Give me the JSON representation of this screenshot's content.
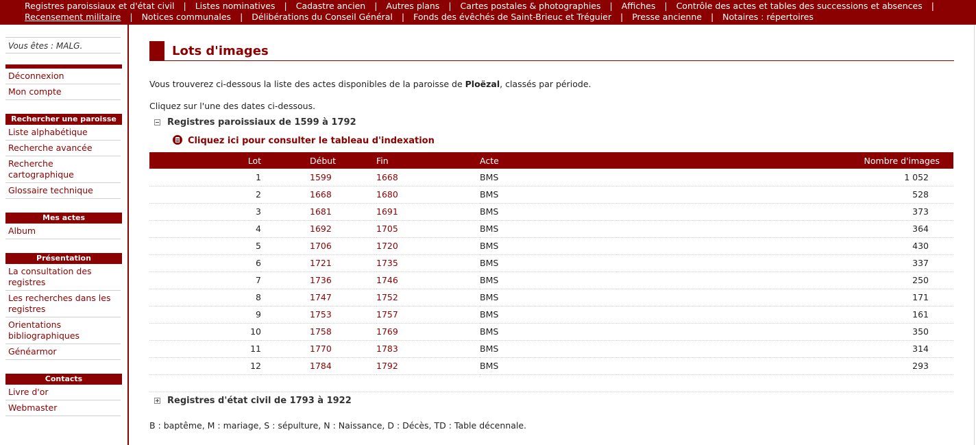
{
  "topnav": {
    "row1": [
      "Registres paroissiaux et d'état civil",
      "Listes nominatives",
      "Cadastre ancien",
      "Autres plans",
      "Cartes postales & photographies",
      "Affiches",
      "Contrôle des actes et tables des successions et absences"
    ],
    "row2": [
      "Recensement militaire",
      "Notices communales",
      "Délibérations du Conseil Général",
      "Fonds des évêchés de Saint-Brieuc et Tréguier",
      "Presse ancienne",
      "Notaires : répertoires"
    ],
    "separator": "|"
  },
  "sidebar": {
    "user": "Vous êtes : MALG.",
    "account": [
      "Déconnexion",
      "Mon compte"
    ],
    "search": {
      "heading": "Rechercher une paroisse",
      "items": [
        "Liste alphabétique",
        "Recherche avancée",
        "Recherche cartographique",
        "Glossaire technique"
      ]
    },
    "mes_actes": {
      "heading": "Mes actes",
      "items": [
        "Album"
      ]
    },
    "presentation": {
      "heading": "Présentation",
      "items": [
        "La consultation des registres",
        "Les recherches dans les registres",
        "Orientations bibliographiques",
        "Généarmor"
      ]
    },
    "contacts": {
      "heading": "Contacts",
      "items": [
        "Livre d'or",
        "Webmaster"
      ]
    }
  },
  "main": {
    "title": "Lots d'images",
    "intro_before": "Vous trouverez ci-dessous la liste des actes disponibles de la paroisse de ",
    "parish": "Ploëzal",
    "intro_after": ", classés par période.",
    "instruction": "Cliquez sur l'une des dates ci-dessous.",
    "section1": "Registres paroissiaux de 1599 à 1792",
    "index_link": "Cliquez ici pour consulter le tableau d'indexation",
    "table": {
      "headers": [
        "Lot",
        "Début",
        "Fin",
        "Acte",
        "Nombre d'images"
      ],
      "rows": [
        [
          "1",
          "1599",
          "1668",
          "BMS",
          "1 052"
        ],
        [
          "2",
          "1668",
          "1680",
          "BMS",
          "528"
        ],
        [
          "3",
          "1681",
          "1691",
          "BMS",
          "373"
        ],
        [
          "4",
          "1692",
          "1705",
          "BMS",
          "364"
        ],
        [
          "5",
          "1706",
          "1720",
          "BMS",
          "430"
        ],
        [
          "6",
          "1721",
          "1735",
          "BMS",
          "337"
        ],
        [
          "7",
          "1736",
          "1746",
          "BMS",
          "250"
        ],
        [
          "8",
          "1747",
          "1752",
          "BMS",
          "171"
        ],
        [
          "9",
          "1753",
          "1757",
          "BMS",
          "161"
        ],
        [
          "10",
          "1758",
          "1769",
          "BMS",
          "350"
        ],
        [
          "11",
          "1770",
          "1783",
          "BMS",
          "314"
        ],
        [
          "12",
          "1784",
          "1792",
          "BMS",
          "293"
        ]
      ]
    },
    "section2": "Registres d'état civil de 1793 à 1922",
    "legend": "B : baptême, M : mariage, S : sépulture, N : Naissance, D : Décès, TD : Table décennale."
  },
  "colors": {
    "brand": "#8b0000",
    "text": "#222222"
  }
}
